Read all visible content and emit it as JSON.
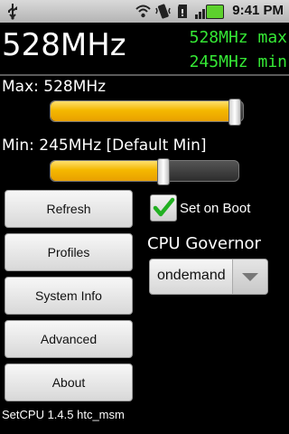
{
  "status_bar": {
    "time": "9:41 PM",
    "icons": [
      "usb-icon",
      "wifi-icon",
      "vibrate-icon",
      "sd-card-icon",
      "signal-icon",
      "battery-icon"
    ]
  },
  "header": {
    "current_freq": "528MHz",
    "max_readout": "528MHz max",
    "min_readout": "245MHz min"
  },
  "max_slider": {
    "label": "Max: 528MHz",
    "level": 0.98
  },
  "min_slider": {
    "label": "Min: 245MHz [Default Min]",
    "level": 0.6
  },
  "buttons": {
    "refresh": "Refresh",
    "profiles": "Profiles",
    "system_info": "System Info",
    "advanced": "Advanced",
    "about": "About"
  },
  "set_on_boot": {
    "label": "Set on Boot",
    "checked": true
  },
  "governor": {
    "title": "CPU Governor",
    "selected": "ondemand"
  },
  "footer": {
    "text": "SetCPU 1.4.5 htc_msm"
  },
  "colors": {
    "readout": "#35e835",
    "slider_fill": "#f5b800",
    "check": "#21b021"
  }
}
